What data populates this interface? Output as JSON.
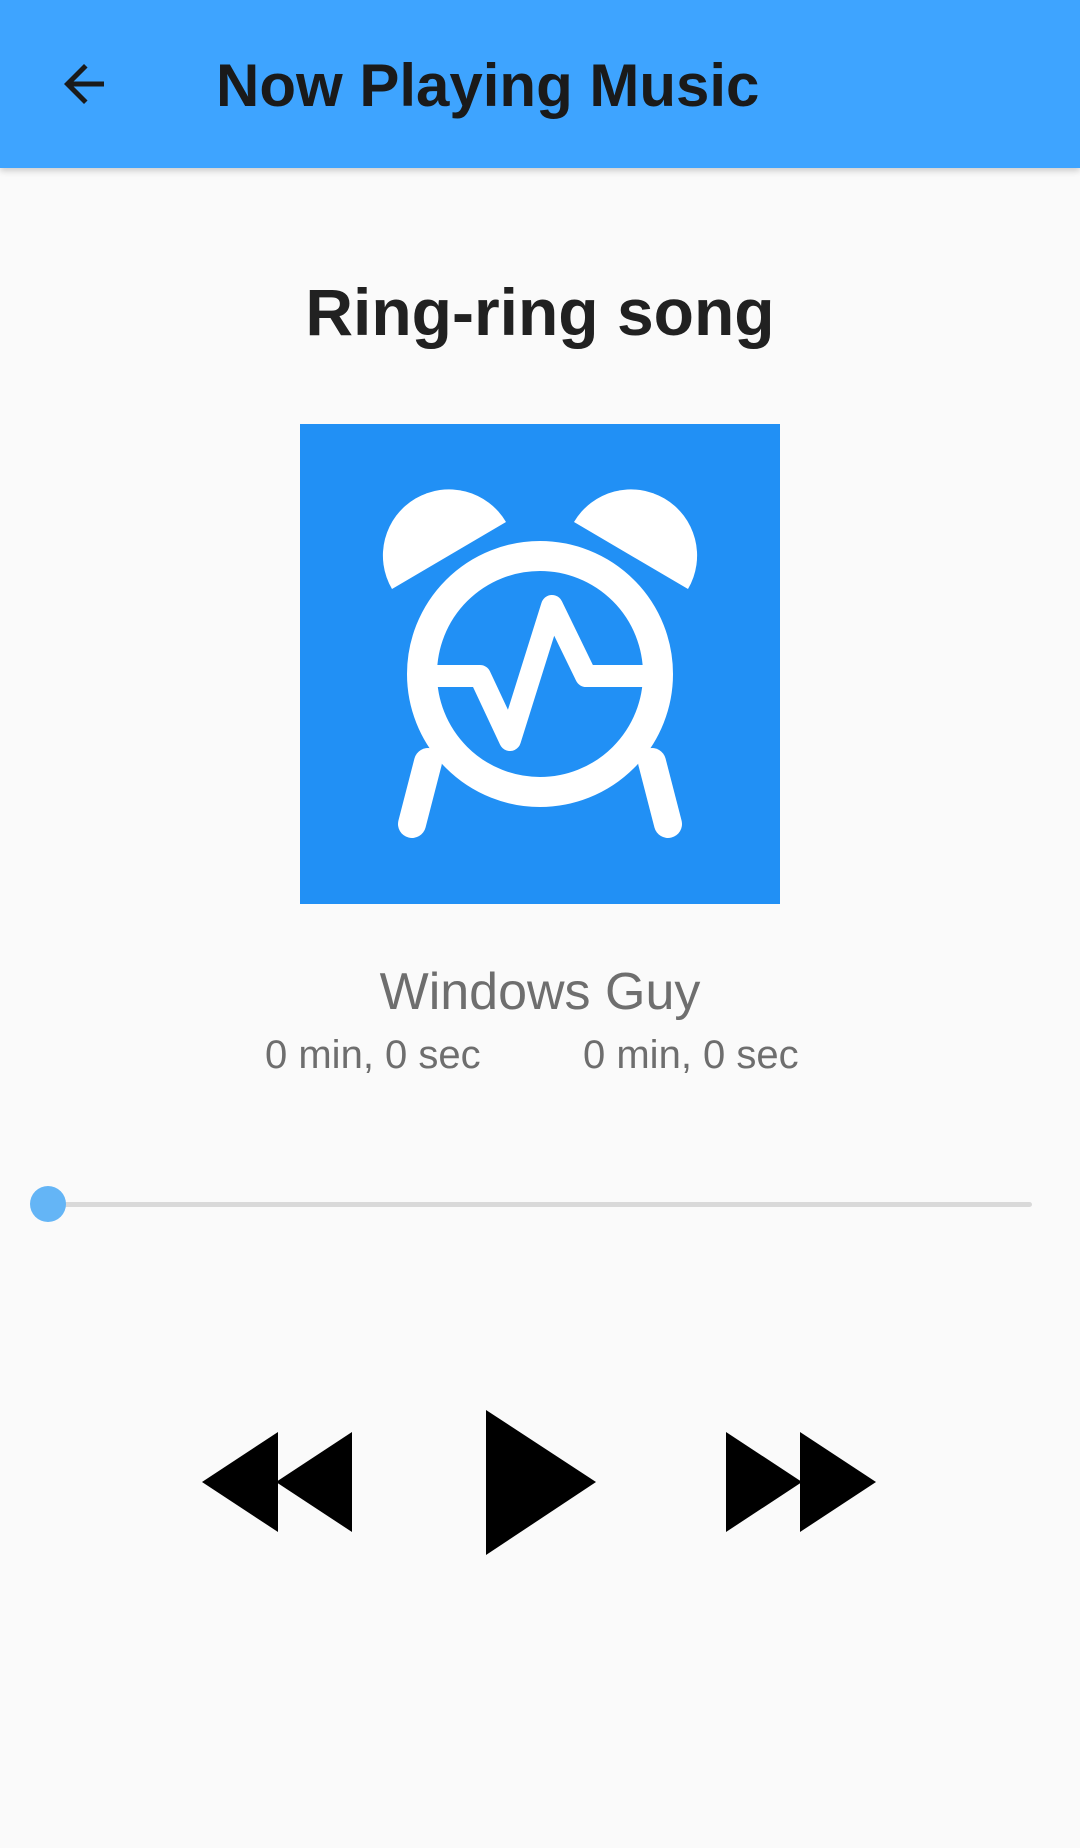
{
  "header": {
    "title": "Now Playing Music",
    "back_icon": "arrow-back-icon",
    "background_color": "#3ea4ff"
  },
  "track": {
    "title": "Ring-ring song",
    "artist": "Windows Guy",
    "artwork_icon": "alarm-clock-icon",
    "artwork_color": "#2190f5",
    "elapsed": "0 min, 0 sec",
    "duration": "0 min, 0 sec"
  },
  "seekbar": {
    "progress": 0,
    "accent_color": "#64b5f6"
  },
  "controls": {
    "rewind_icon": "rewind-icon",
    "play_icon": "play-icon",
    "fast_forward_icon": "fast-forward-icon"
  }
}
